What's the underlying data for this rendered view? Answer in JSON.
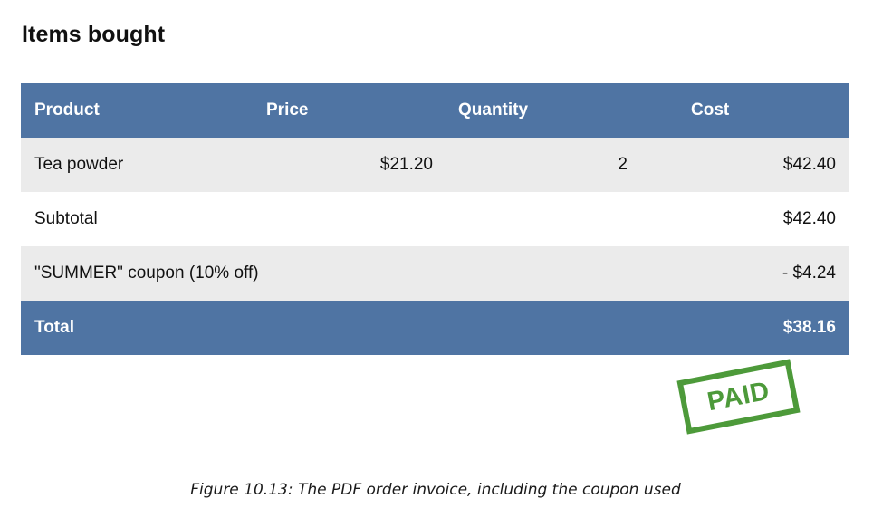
{
  "heading": "Items bought",
  "table": {
    "headers": {
      "product": "Product",
      "price": "Price",
      "quantity": "Quantity",
      "cost": "Cost"
    },
    "items": [
      {
        "product": "Tea powder",
        "price": "$21.20",
        "quantity": "2",
        "cost": "$42.40"
      }
    ],
    "subtotal": {
      "label": "Subtotal",
      "value": "$42.40"
    },
    "coupon": {
      "label": "\"SUMMER\" coupon (10% off)",
      "value": "- $4.24"
    },
    "total": {
      "label": "Total",
      "value": "$38.16"
    }
  },
  "stamp": {
    "text": "PAID",
    "color": "#4d9a3a"
  },
  "colors": {
    "header_bg": "#4f74a3",
    "row_alt_bg": "#ebebeb"
  },
  "caption": "Figure 10.13: The PDF order invoice, including the coupon used"
}
